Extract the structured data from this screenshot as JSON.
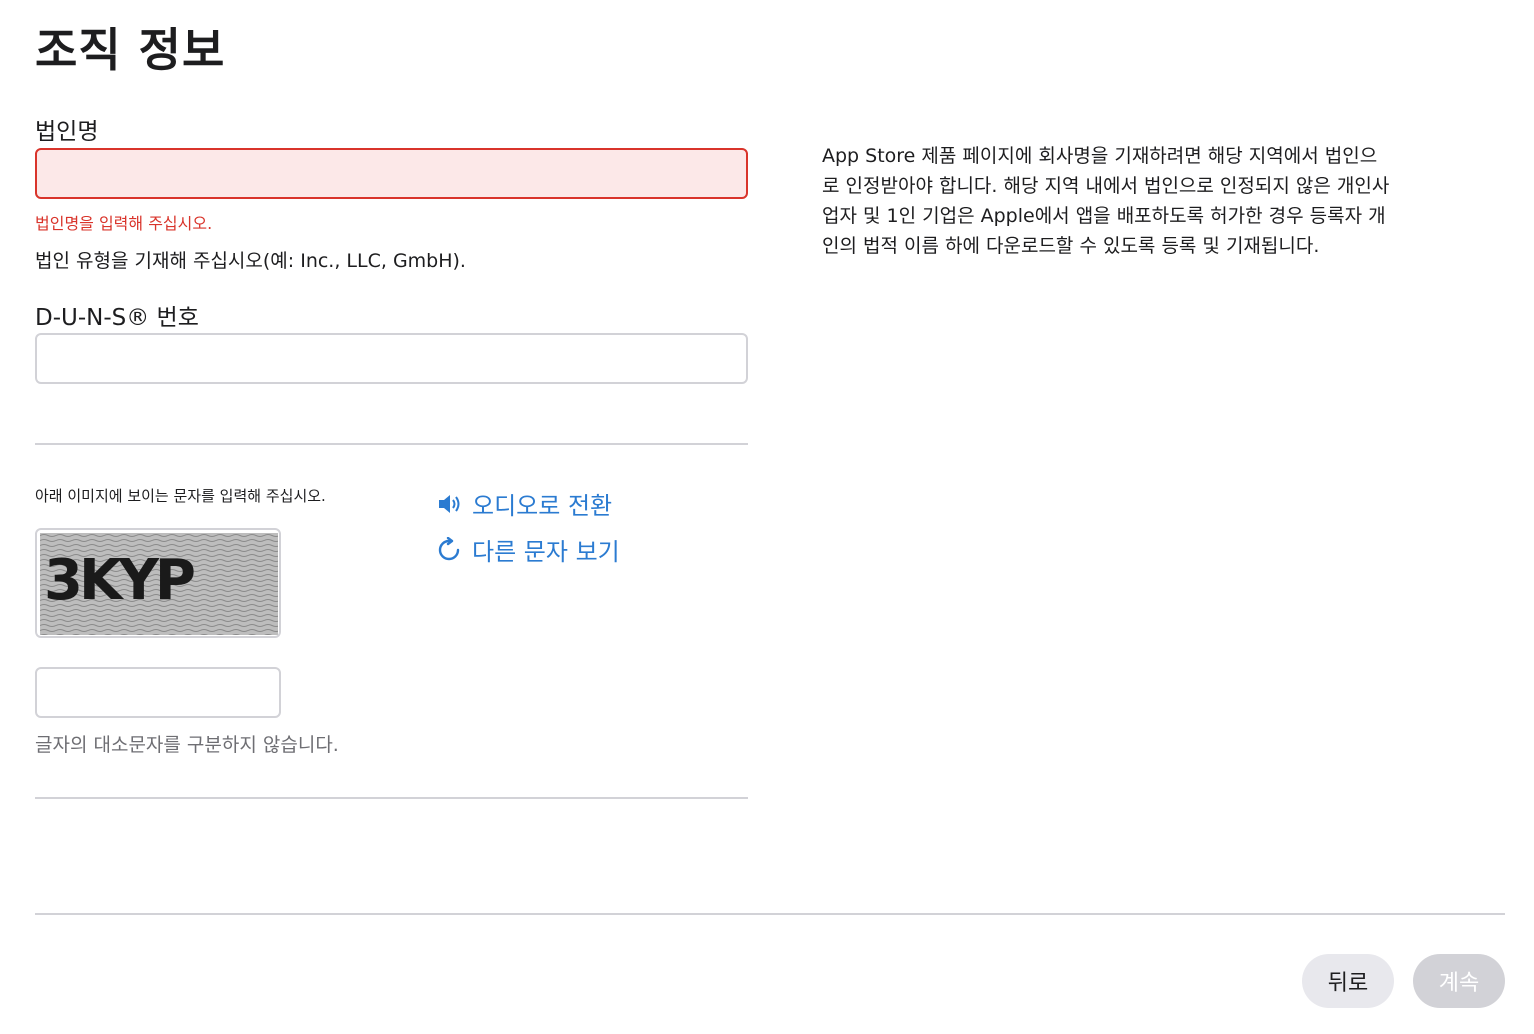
{
  "page": {
    "title": "조직 정보"
  },
  "legal_entity": {
    "label": "법인명",
    "value": "",
    "error": "법인명을 입력해 주십시오.",
    "hint": "법인 유형을 기재해 주십시오(예: Inc., LLC, GmbH)."
  },
  "duns": {
    "label": "D-U-N-S® 번호",
    "value": ""
  },
  "info": {
    "text": "App Store 제품 페이지에 회사명을 기재하려면 해당 지역에서 법인으로 인정받아야 합니다. 해당 지역 내에서 법인으로 인정되지 않은 개인사업자 및 1인 기업은 Apple에서 앱을 배포하도록 허가한 경우 등록자 개인의 법적 이름 하에 다운로드할 수 있도록 등록 및 기재됩니다."
  },
  "captcha": {
    "prompt": "아래 이미지에 보이는 문자를 입력해 주십시오.",
    "image_text": "3KYP",
    "audio_link": "오디오로 전환",
    "refresh_link": "다른 문자 보기",
    "value": "",
    "case_note": "글자의 대소문자를 구분하지 않습니다."
  },
  "footer": {
    "back_label": "뒤로",
    "continue_label": "계속"
  },
  "colors": {
    "error": "#d9342b",
    "link": "#2b7bd1",
    "error_field_bg": "#fce8e8",
    "disabled_button": "#d2d2d7"
  },
  "icons": {
    "audio": "speaker-icon",
    "refresh": "refresh-icon"
  }
}
